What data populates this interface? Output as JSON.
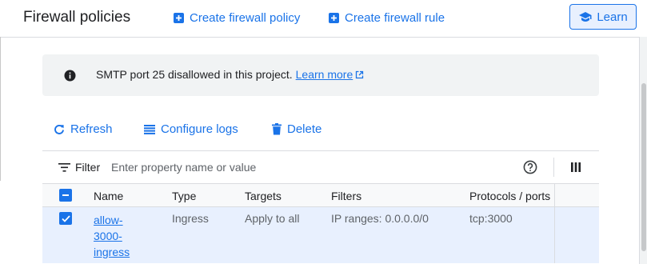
{
  "header": {
    "title": "Firewall policies",
    "create_policy": "Create firewall policy",
    "create_rule": "Create firewall rule",
    "learn": "Learn"
  },
  "notice": {
    "icon": "info-icon",
    "text": "SMTP port 25 disallowed in this project.",
    "link": "Learn more"
  },
  "toolbar": {
    "refresh": "Refresh",
    "configure_logs": "Configure logs",
    "delete": "Delete"
  },
  "filter": {
    "label": "Filter",
    "placeholder": "Enter property name or value"
  },
  "table": {
    "columns": [
      "Name",
      "Type",
      "Targets",
      "Filters",
      "Protocols / ports"
    ],
    "rows": [
      {
        "name": "allow-3000-ingress",
        "type": "Ingress",
        "targets": "Apply to all",
        "filters": "IP ranges: 0.0.0.0/0",
        "protocols": "tcp:3000",
        "selected": true
      }
    ]
  },
  "colors": {
    "accent": "#1a73e8",
    "notice_bg": "#f1f3f4",
    "selected_row": "#e8f0fe"
  }
}
